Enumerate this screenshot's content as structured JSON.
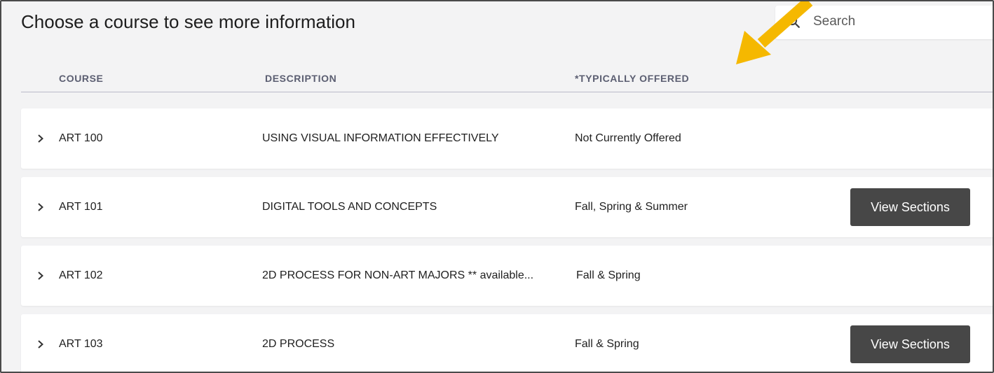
{
  "page": {
    "title": "Choose a course to see more information"
  },
  "search": {
    "placeholder": "Search",
    "value": ""
  },
  "table": {
    "columns": [
      "COURSE",
      "DESCRIPTION",
      "*TYPICALLY OFFERED"
    ],
    "rows": [
      {
        "code": "ART 100",
        "description": "USING VISUAL INFORMATION EFFECTIVELY",
        "offered": "Not Currently Offered",
        "action": null
      },
      {
        "code": "ART 101",
        "description": "DIGITAL TOOLS AND CONCEPTS",
        "offered": "Fall, Spring & Summer",
        "action": "View Sections"
      },
      {
        "code": "ART 102",
        "description": "2D PROCESS FOR NON-ART MAJORS ** available...",
        "offered": "Fall & Spring",
        "action": null
      },
      {
        "code": "ART 103",
        "description": "2D PROCESS",
        "offered": "Fall & Spring",
        "action": "View Sections"
      }
    ]
  },
  "icons": {
    "search": "search-icon",
    "expand": "chevron-right-icon",
    "annotation": "arrow-icon"
  },
  "colors": {
    "background": "#f3f3f4",
    "header_text": "#5b5e71",
    "button_bg": "#474747",
    "annotation_arrow": "#f5b800"
  }
}
